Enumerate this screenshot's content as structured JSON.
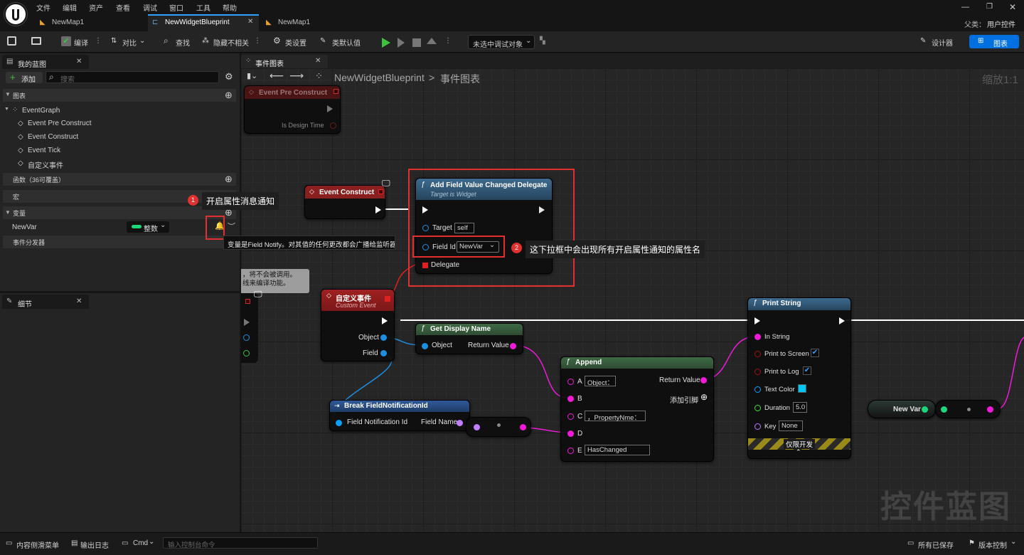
{
  "menu": [
    "文件",
    "编辑",
    "资产",
    "查看",
    "调试",
    "窗口",
    "工具",
    "帮助"
  ],
  "tabs": [
    "NewMap1",
    "NewWidgetBlueprint",
    "NewMap1"
  ],
  "parent_class": {
    "label": "父类：",
    "value": "用户控件"
  },
  "toolbar": {
    "compile": "编译",
    "diff": "对比",
    "find": "查找",
    "hide": "隐藏不相关",
    "class_settings": "类设置",
    "class_defaults": "类默认值",
    "debug_target": "未选中调试对象",
    "designer": "设计器",
    "graph": "图表"
  },
  "my_blueprint": {
    "title": "我的蓝图",
    "add": "添加",
    "search_placeholder": "搜索",
    "graphs_header": "图表",
    "event_graph": "EventGraph",
    "events": [
      "Event Pre Construct",
      "Event Construct",
      "Event Tick",
      "自定义事件"
    ],
    "functions_header": "函数（36可覆盖）",
    "macros_header": "宏",
    "variables_header": "变量",
    "var_name": "NewVar",
    "var_type": "整数",
    "dispatchers_header": "事件分发器",
    "tooltip": "变量是Field Notify。对其值的任何更改都会广播给监听器。"
  },
  "details": {
    "title": "细节"
  },
  "graph_tab": {
    "title": "事件图表",
    "bc_root": "NewWidgetBlueprint",
    "bc_sep": ">",
    "bc_leaf": "事件图表",
    "zoom": "缩放1:1",
    "comment": "，将不会被调用。\n线来编译功能。",
    "watermark": "控件蓝图"
  },
  "annotations": [
    {
      "num": "1",
      "text": "开启属性消息通知"
    },
    {
      "num": "2",
      "text": "这下拉框中会出现所有开启属性通知的属性名"
    }
  ],
  "nodes": {
    "pre_construct": {
      "title": "Event Pre Construct",
      "pin": "Is Design Time"
    },
    "event_construct": {
      "title": "Event Construct"
    },
    "add_delegate": {
      "title": "Add Field Value Changed Delegate",
      "subtitle": "Target is Widget",
      "target": "Target",
      "target_val": "self",
      "field_id": "Field Id",
      "field_val": "NewVar",
      "delegate": "Delegate"
    },
    "custom_event": {
      "title": "自定义事件",
      "subtitle": "Custom Event",
      "object": "Object",
      "field": "Field"
    },
    "get_display": {
      "title": "Get Display Name",
      "object": "Object",
      "ret": "Return Value"
    },
    "break_field": {
      "title": "Break FieldNotificationId",
      "input": "Field Notification Id",
      "output": "Field Name"
    },
    "append": {
      "title": "Append",
      "ret": "Return Value",
      "add_pin": "添加引脚",
      "pins": [
        "A",
        "B",
        "C",
        "D",
        "E"
      ],
      "a_val": "Object：",
      "c_val": "，PropertyNme：",
      "e_val": "HasChanged"
    },
    "print_string": {
      "title": "Print String",
      "in_string": "In String",
      "print_screen": "Print to Screen",
      "print_log": "Print to Log",
      "text_color": "Text Color",
      "duration": "Duration",
      "duration_val": "5.0",
      "key": "Key",
      "key_val": "None",
      "dev_only": "仅限开发"
    },
    "new_var": {
      "title": "New Var"
    }
  },
  "statusbar": {
    "content_drawer": "内容侧滑菜单",
    "output_log": "输出日志",
    "cmd": "Cmd",
    "console_placeholder": "输入控制台命令",
    "saved": "所有已保存",
    "source_control": "版本控制"
  },
  "colors": {
    "accent": "#2ea0ff",
    "annotation": "#e03030",
    "exec_head": "#8a1f1f",
    "function_head": "#26455e",
    "pure_head": "#2f4b33",
    "struct_head": "#1f3c66",
    "object_pin": "#1c8fe0",
    "string_pin": "#f01ad8",
    "bool_pin": "#8b0000",
    "struct_pin": "#0aa0ff",
    "float_pin": "#2eea2e",
    "name_pin": "#c27eff"
  }
}
